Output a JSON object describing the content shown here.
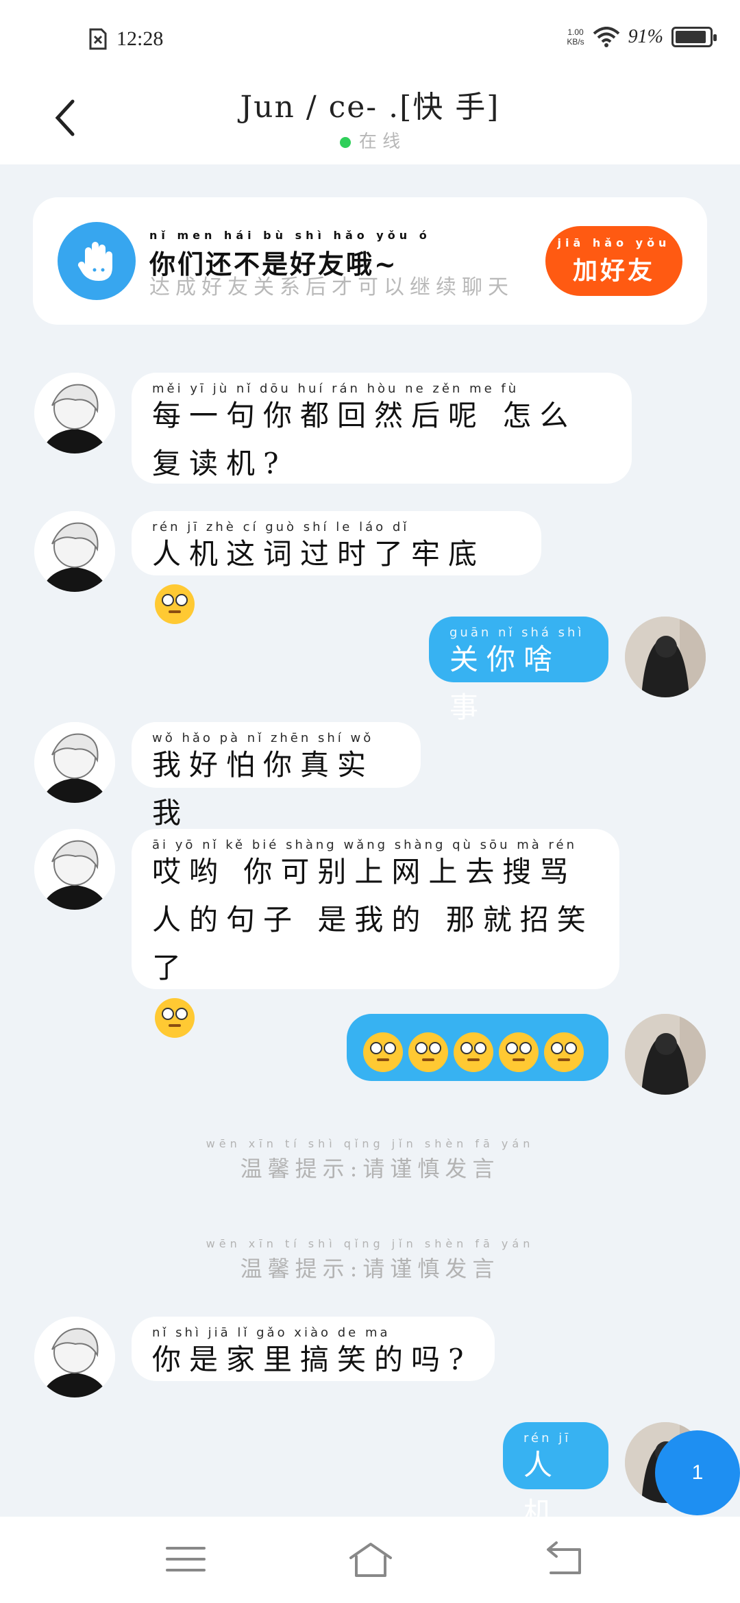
{
  "status_bar": {
    "time": "12:28",
    "net_speed": "1.00",
    "net_unit": "KB/s",
    "battery": "91%",
    "battery_level": 0.91,
    "icons": [
      "sim-error-icon",
      "wifi-icon",
      "battery-icon"
    ]
  },
  "header": {
    "title": "Jun / ce- .[快 手]",
    "status": "在 线"
  },
  "friend_card": {
    "headline": "你们还不是好友哦~",
    "headline_pinyin": "nǐ men hái bù shì hǎo yǒu ó",
    "subline": "达成好友关系后才可以继续聊天",
    "button": "加好友",
    "button_pinyin": "jiā hǎo yǒu"
  },
  "messages": [
    {
      "side": "in",
      "pinyin": "měi yī jù nǐ dōu huí rán hòu ne zěn me fù",
      "text": "每一句你都回然后呢 怎么复读机?"
    },
    {
      "side": "in",
      "pinyin": "rén jī zhè cí guò shí le láo dǐ",
      "text": "人机这词过时了牢底"
    },
    {
      "side": "out",
      "pinyin": "guān nǐ shá shì",
      "text": "关你啥事"
    },
    {
      "side": "in",
      "pinyin": "wǒ hǎo pà nǐ zhēn shí wǒ",
      "text": "我好怕你真实我"
    },
    {
      "side": "in",
      "pinyin": "āi yō nǐ kě bié shàng wǎng shàng qù sōu mà rén",
      "text": "哎哟 你可别上网上去搜骂人的句子 是我的 那就招笑了"
    },
    {
      "side": "out",
      "pinyin": "",
      "text": ""
    },
    {
      "side": "in",
      "pinyin": "nǐ shì jiā lǐ gǎo xiào de ma",
      "text": "你是家里搞笑的吗?"
    },
    {
      "side": "out",
      "pinyin": "rén jī",
      "text": "人机"
    }
  ],
  "tips": {
    "text": "温馨提示:请谨慎发言",
    "pinyin": "wēn xīn tí shì qǐng jǐn shèn fā yán"
  },
  "unread_count": "1"
}
